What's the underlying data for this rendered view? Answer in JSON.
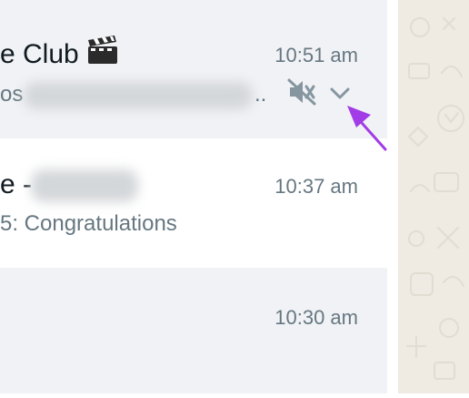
{
  "chats": [
    {
      "name_visible": "e Club",
      "name_emoji_icon": "clapper-board-icon",
      "time": "10:51 am",
      "preview_prefix": "os",
      "preview_suffix": "..",
      "muted_icon": "muted-speaker-icon",
      "menu_icon": "chevron-down-icon"
    },
    {
      "name_visible": "e -",
      "time": "10:37 am",
      "preview": "5: Congratulations"
    },
    {
      "time": "10:30 am"
    }
  ],
  "colors": {
    "row_selected": "#f0f2f5",
    "row_default": "#ffffff",
    "wallpaper": "#efeae2",
    "annotation_arrow": "#a23ce6",
    "secondary_text": "#667781"
  }
}
